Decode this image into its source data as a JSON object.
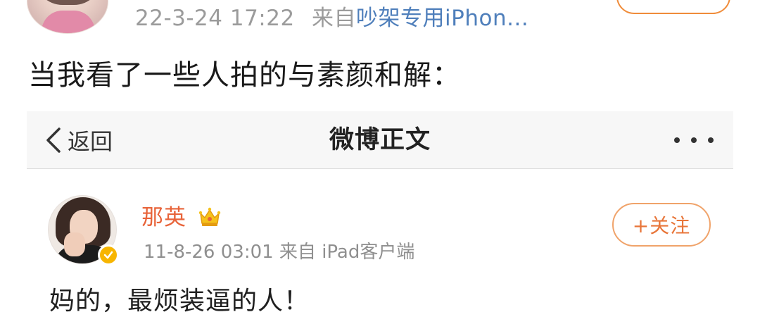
{
  "outer_post": {
    "time": "22-3-24 17:22",
    "source_prefix": "来自",
    "source_device": "吵架专用iPhon...",
    "text": "当我看了一些人拍的与素颜和解："
  },
  "embedded_screenshot": {
    "nav": {
      "back_label": "返回",
      "title": "微博正文"
    },
    "post": {
      "username": "那英",
      "meta": "11-8-26 03:01  来自 iPad客户端",
      "follow_label": "+关注",
      "text": "妈的，最烦装逼的人！",
      "username_color": "#e8643a",
      "follow_color": "#e8763a"
    }
  },
  "icons": [
    "avatar",
    "back-chevron-icon",
    "more-dots-icon",
    "crown-icon",
    "verified-badge-icon"
  ]
}
